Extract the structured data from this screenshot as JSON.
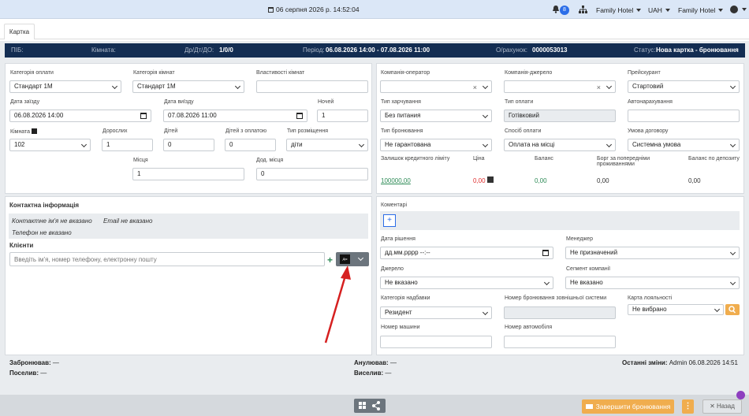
{
  "topbar": {
    "datetime": "06 серпня 2026 р. 14:52:04",
    "badge": "8",
    "hotel1": "Family Hotel",
    "currency": "UAH",
    "hotel2": "Family Hotel"
  },
  "tab": {
    "label": "Картка"
  },
  "infobar": {
    "name_label": "ПІБ:",
    "rooms_label": "Кімната:",
    "guests_label": "Др/Дт/ДО:",
    "guests_value": "1/0/0",
    "period_label": "Період:",
    "period_value": "06.08.2026 14:00 - 07.08.2026 11:00",
    "invoice_label": "О/рахунок:",
    "invoice_value": "0000053013",
    "status_label": "Статус:",
    "status_value": "Нова картка - бронювання"
  },
  "left": {
    "payment_category_label": "Категорія оплати",
    "payment_category": "Стандарт 1М",
    "room_category_label": "Категорія кімнат",
    "room_category": "Стандарт 1М",
    "room_props_label": "Властивості кімнат",
    "checkin_label": "Дата заїзду",
    "checkin": "06.08.2026 14:00",
    "checkout_label": "Дата виїзду",
    "checkout": "07.08.2026 11:00",
    "nights_label": "Ночей",
    "nights": "1",
    "room_label": "Кімната",
    "room": "102",
    "adults_label": "Дорослих",
    "adults": "1",
    "children_label": "Дітей",
    "children": "0",
    "paid_children_label": "Дітей з оплатою",
    "paid_children": "0",
    "placement_label": "Тип розміщення",
    "placement": "діти",
    "places_label": "Місця",
    "places": "1",
    "extra_places_label": "Дод. місця",
    "extra_places": "0"
  },
  "right": {
    "operator_label": "Компанія-оператор",
    "source_label": "Компанія-джерело",
    "pricelist_label": "Прейскурант",
    "pricelist": "Стартовий",
    "meal_label": "Тип харчування",
    "meal": "Без питания",
    "paytype_label": "Тип оплати",
    "paytype": "Готівковий",
    "autocharge_label": "Автонарахування",
    "booking_type_label": "Тип бронювання",
    "booking_type": "Не гарантована",
    "paymethod_label": "Спосіб оплати",
    "paymethod": "Оплата на місці",
    "contract_label": "Умова договору",
    "contract": "Системна умова",
    "credit_label": "Залишок кредитного ліміту",
    "credit": "100000,00",
    "price_label": "Ціна",
    "price": "0,00",
    "balance_label": "Баланс",
    "balance": "0,00",
    "debt_label": "Борг за попередніми проживаннями",
    "debt": "0,00",
    "deposit_label": "Баланс по депозиту",
    "deposit": "0,00"
  },
  "contacts": {
    "title": "Контактна інформація",
    "name": "Контактне ім'я не вказано",
    "email": "Email не вказано",
    "phone": "Телефон не вказано",
    "clients_title": "Клієнти",
    "clients_placeholder": "Введіть ім'я, номер телефону, електронну пошту",
    "action_label": "Дія"
  },
  "details": {
    "comments_label": "Коментарі",
    "decision_date_label": "Дата рішення",
    "decision_date": "дд.мм.рррр --:--",
    "manager_label": "Менеджер",
    "manager": "Не призначений",
    "source_label": "Джерело",
    "source": "Не вказано",
    "segment_label": "Сегмент компанії",
    "segment": "Не вказано",
    "surcharge_label": "Категорія надбавки",
    "surcharge": "Резидент",
    "ext_booking_label": "Номер бронювання зовнішньої системи",
    "loyalty_label": "Карта лояльності",
    "loyalty": "Не вибрано",
    "car_label": "Номер машини",
    "car_number_label": "Номер автомобіля"
  },
  "footer": {
    "booked_label": "Забронював:",
    "booked": "—",
    "settled_label": "Поселив:",
    "settled": "—",
    "cancelled_label": "Анулював:",
    "cancelled": "—",
    "evicted_label": "Виселив:",
    "evicted": "—",
    "changes_label": "Останні зміни:",
    "changes": "Admin 06.08.2026 14:51"
  },
  "bottom": {
    "finish_label": "Завершити бронювання",
    "dots": "⋮",
    "back_label": "Назад"
  }
}
